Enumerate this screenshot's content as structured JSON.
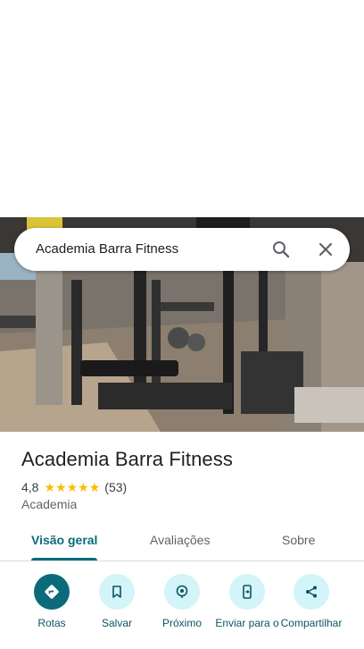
{
  "search": {
    "query": "Academia Barra Fitness"
  },
  "place": {
    "title": "Academia Barra Fitness",
    "rating": "4,8",
    "stars": 5,
    "reviews": "(53)",
    "category": "Academia"
  },
  "tabs": [
    {
      "label": "Visão geral",
      "active": true
    },
    {
      "label": "Avaliações",
      "active": false
    },
    {
      "label": "Sobre",
      "active": false
    }
  ],
  "actions": [
    {
      "label": "Rotas",
      "icon": "directions-icon"
    },
    {
      "label": "Salvar",
      "icon": "bookmark-icon"
    },
    {
      "label": "Próximo",
      "icon": "nearby-icon"
    },
    {
      "label": "Enviar para o",
      "icon": "send-to-phone-icon"
    },
    {
      "label": "Compartilhar",
      "icon": "share-icon"
    }
  ],
  "colors": {
    "accent": "#0b6b7a",
    "action_bg": "#d3f4f9",
    "star": "#fbbc04"
  }
}
